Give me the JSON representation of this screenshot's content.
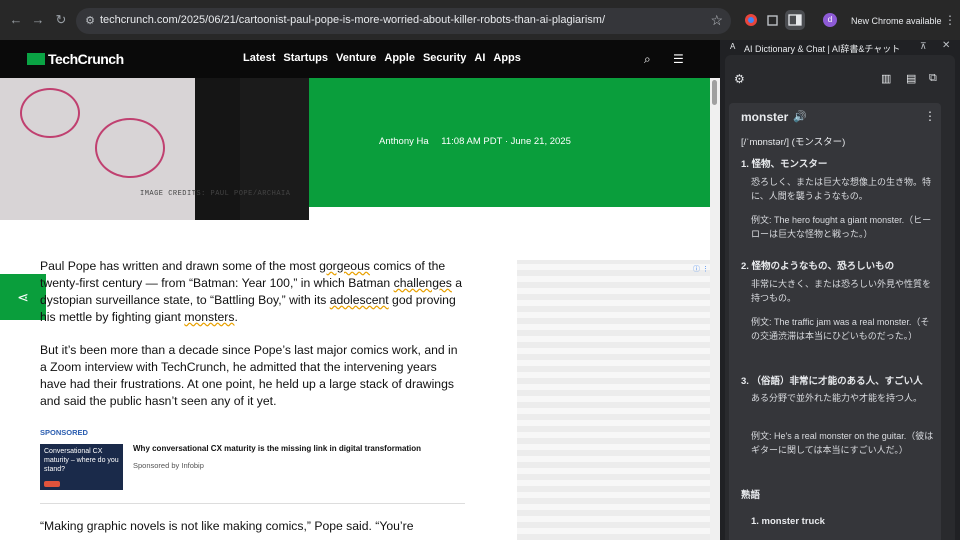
{
  "browser": {
    "url": "techcrunch.com/2025/06/21/cartoonist-paul-pope-is-more-worried-about-killer-robots-than-ai-plagiarism/",
    "profile_initial": "d",
    "update_label": "New Chrome available"
  },
  "site": {
    "logo": "TechCrunch",
    "nav": [
      "Latest",
      "Startups",
      "Venture",
      "Apple",
      "Security",
      "AI",
      "Apps"
    ]
  },
  "hero": {
    "credits": "IMAGE CREDITS: PAUL POPE/ARCHAIA",
    "author": "Anthony Ha",
    "datetime": "11:08 AM PDT · June 21, 2025"
  },
  "article": {
    "p1_a": "Paul Pope has written and drawn some of the most ",
    "p1_w1": "gorgeous",
    "p1_b": " comics of the twenty-first century — from “Batman: Year 100,” in which Batman ",
    "p1_w2": "challenges",
    "p1_c": " a dystopian surveillance state, to “Battling Boy,” with its ",
    "p1_w3": "adolescent",
    "p1_d": " god proving his mettle by fighting giant ",
    "p1_w4": "monsters",
    "p1_e": ".",
    "p2": "But it’s been more than a decade since Pope’s last major comics work, and in a Zoom interview with TechCrunch, he admitted that the intervening years have had their frustrations. At one point, he held up a large stack of drawings and said the public hasn’t seen any of it yet.",
    "p3": "“Making graphic novels is not like making comics,” Pope said. “You’re"
  },
  "sponsored": {
    "label": "SPONSORED",
    "image_text": "Conversational CX maturity – where do you stand?",
    "title": "Why conversational CX maturity is the missing link in digital transformation",
    "by": "Sponsored by Infobip"
  },
  "panel": {
    "title": "AI Dictionary & Chat | AI辞書&チャット",
    "word": "monster",
    "pronunciation": "[/ˈmɒnstər/] (モンスター)",
    "defs": [
      {
        "head": "1. 怪物、モンスター",
        "body": "恐ろしく、または巨大な想像上の生き物。特に、人間を襲うようなもの。",
        "example": "例文: The hero fought a giant monster.（ヒーローは巨大な怪物と戦った。）"
      },
      {
        "head": "2. 怪物のようなもの、恐ろしいもの",
        "body": "非常に大きく、または恐ろしい外見や性質を持つもの。",
        "example": "例文: The traffic jam was a real monster.（その交通渋滞は本当にひどいものだった。）"
      },
      {
        "head": "3. （俗語）非常に才能のある人、すごい人",
        "body": "ある分野で並外れた能力や才能を持つ人。",
        "example": "例文: He's a real monster on the guitar.（彼はギターに関しては本当にすごい人だ。）"
      }
    ],
    "phrases_head": "熟語",
    "phrase1": "1. monster truck"
  },
  "colors": {
    "tc_green": "#0a9e3c",
    "panel_bg": "#292a2d",
    "card_bg": "#35363a"
  }
}
